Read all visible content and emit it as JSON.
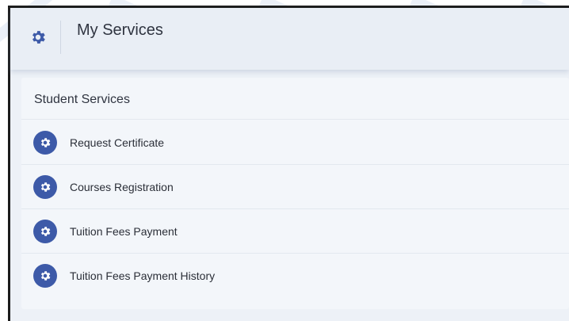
{
  "header": {
    "title": "My Services",
    "icon": "gear-icon"
  },
  "section": {
    "title": "Student Services",
    "items": [
      {
        "label": "Request Certificate",
        "icon": "gear-icon"
      },
      {
        "label": "Courses Registration",
        "icon": "gear-icon"
      },
      {
        "label": "Tuition Fees Payment",
        "icon": "gear-icon"
      },
      {
        "label": "Tuition Fees Payment History",
        "icon": "gear-icon"
      }
    ]
  },
  "colors": {
    "accent": "#3d5aa8",
    "header_bg": "#e9eef5",
    "card_bg": "#f3f6fa",
    "page_bg": "#edf1f7"
  }
}
